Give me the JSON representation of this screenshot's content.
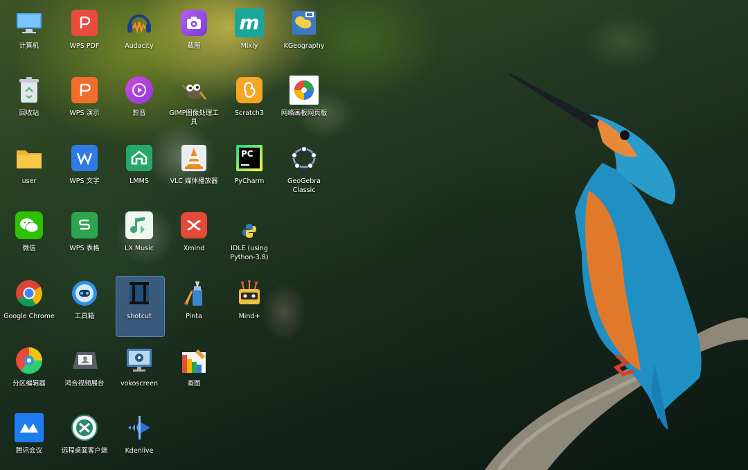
{
  "desktop": {
    "icons": [
      {
        "label": "计算机",
        "icon": "computer-icon"
      },
      {
        "label": "WPS PDF",
        "icon": "wps-pdf-icon"
      },
      {
        "label": "Audacity",
        "icon": "audacity-icon"
      },
      {
        "label": "截图",
        "icon": "screenshot-icon"
      },
      {
        "label": "Mixly",
        "icon": "mixly-icon"
      },
      {
        "label": "KGeography",
        "icon": "kgeography-icon"
      },
      {
        "label": "回收站",
        "icon": "trash-icon"
      },
      {
        "label": "WPS 演示",
        "icon": "wps-presentation-icon"
      },
      {
        "label": "影音",
        "icon": "media-player-icon"
      },
      {
        "label": "GIMP图像处理工具",
        "icon": "gimp-icon"
      },
      {
        "label": "Scratch3",
        "icon": "scratch-icon"
      },
      {
        "label": "网络画板网页版",
        "icon": "netboard-icon"
      },
      {
        "label": "user",
        "icon": "folder-icon"
      },
      {
        "label": "WPS 文字",
        "icon": "wps-writer-icon"
      },
      {
        "label": "LMMS",
        "icon": "lmms-icon"
      },
      {
        "label": "VLC 媒体播放器",
        "icon": "vlc-icon"
      },
      {
        "label": "PyCharm",
        "icon": "pycharm-icon"
      },
      {
        "label": "GeoGebra Classic",
        "icon": "geogebra-icon"
      },
      {
        "label": "微信",
        "icon": "wechat-icon"
      },
      {
        "label": "WPS 表格",
        "icon": "wps-spreadsheet-icon"
      },
      {
        "label": "LX Music",
        "icon": "lx-music-icon"
      },
      {
        "label": "Xmind",
        "icon": "xmind-icon"
      },
      {
        "label": "IDLE (using Python-3.8)",
        "icon": "python-idle-icon"
      },
      {
        "label": "Google Chrome",
        "icon": "chrome-icon"
      },
      {
        "label": "工具箱",
        "icon": "toolbox-icon"
      },
      {
        "label": "shotcut",
        "icon": "shotcut-icon"
      },
      {
        "label": "Pinta",
        "icon": "pinta-icon"
      },
      {
        "label": "Mind+",
        "icon": "mindplus-icon"
      },
      {
        "label": "分区编辑器",
        "icon": "partition-editor-icon"
      },
      {
        "label": "鸿合视频展台",
        "icon": "video-booth-icon"
      },
      {
        "label": "vokoscreen",
        "icon": "vokoscreen-icon"
      },
      {
        "label": "画图",
        "icon": "paint-icon"
      },
      {
        "label": "腾讯会议",
        "icon": "tencent-meeting-icon"
      },
      {
        "label": "远程桌面客户端",
        "icon": "remote-desktop-icon"
      },
      {
        "label": "Kdenlive",
        "icon": "kdenlive-icon"
      }
    ],
    "selected": "shotcut",
    "wallpaper": "kingfisher-wallpaper",
    "colors": {
      "wps_red": "#e84c3d",
      "wps_blue": "#2f7ae5",
      "wps_green": "#2ea44f",
      "selection": "#5078c8"
    }
  }
}
